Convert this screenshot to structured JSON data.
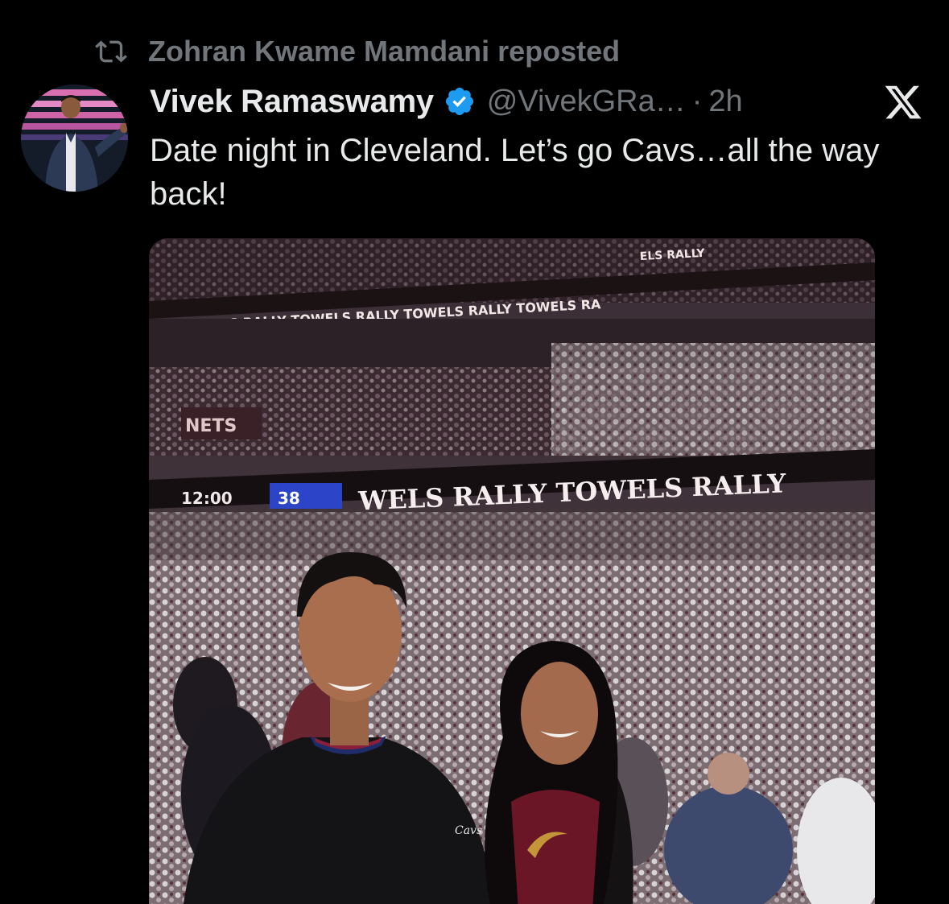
{
  "repost": {
    "icon": "repost-icon",
    "label": "Zohran Kwame Mamdani reposted"
  },
  "author": {
    "display_name": "Vivek Ramaswamy",
    "verified_icon": "verified-badge-icon",
    "handle": "@VivekGRa…",
    "separator": "·",
    "time": "2h",
    "avatar_icon": "avatar"
  },
  "platform_logo": "x-logo-icon",
  "tweet": {
    "text": "Date night in Cleveland. Let’s go Cavs…all the way back!"
  },
  "media": {
    "type": "photo",
    "ribbon_text_upper": "LLY TOWELS RALLY TOWELS RALLY TOWELS RALLY TOWELS RA",
    "ribbon_text_top": "ELS RALLY",
    "ribbon_text_lower": "WELS RALLY TOWELS RALLY",
    "scoreboard_time": "12:00",
    "scoreboard_score": "38"
  },
  "colors": {
    "background": "#000000",
    "text_primary": "#e7e9ea",
    "text_secondary": "#71767b",
    "verified_blue": "#1d9bf0"
  }
}
